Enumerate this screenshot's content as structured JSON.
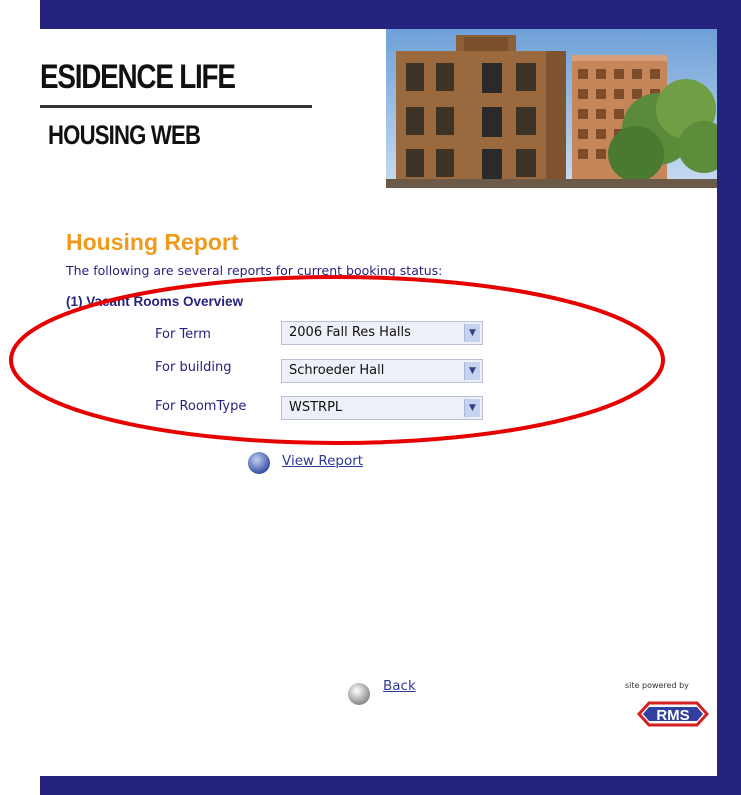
{
  "header": {
    "brand_line1": "ESIDENCE LIFE",
    "brand_line2": "HOUSING WEB"
  },
  "report": {
    "title": "Housing Report",
    "description": "The following are several reports for current booking status:",
    "section_title": "(1) Vacant Rooms Overview",
    "fields": [
      {
        "label": "For Term",
        "value": "2006 Fall Res Halls"
      },
      {
        "label": "For building",
        "value": "Schroeder Hall"
      },
      {
        "label": "For RoomType",
        "value": "WSTRPL"
      }
    ],
    "view_report_label": "View Report"
  },
  "footer": {
    "back_label": "Back",
    "powered_by": "site powered by",
    "logo_text": "RMS"
  },
  "colors": {
    "frame": "#26237e",
    "title_orange": "#f09a1c",
    "text_navy": "#26237e",
    "annotation_red": "#e60000"
  }
}
